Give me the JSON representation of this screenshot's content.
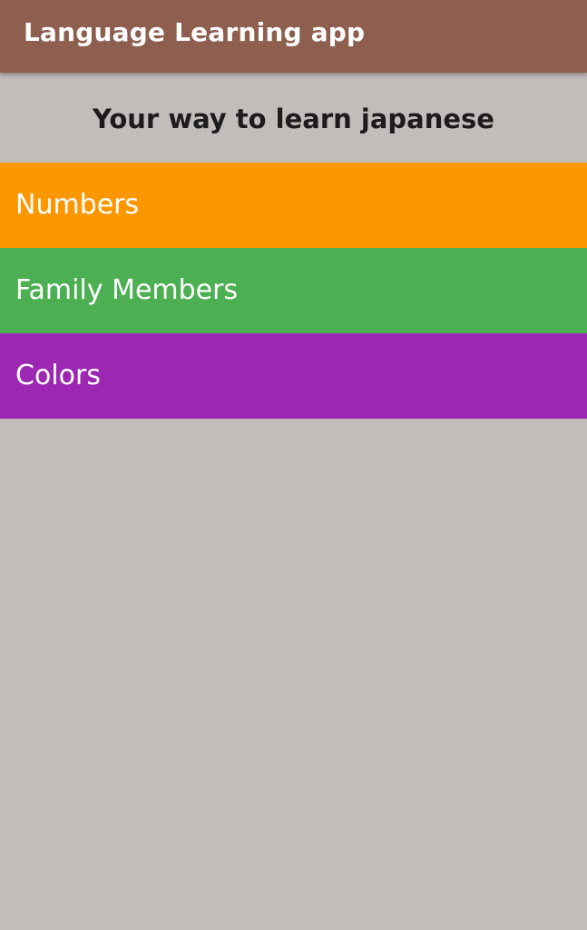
{
  "app_bar": {
    "title": "Language Learning app",
    "color": "#8e5f4e"
  },
  "header": {
    "subtitle": "Your way to learn japanese"
  },
  "categories": [
    {
      "label": "Numbers",
      "color": "#fd9700"
    },
    {
      "label": "Family Members",
      "color": "#4caf51"
    },
    {
      "label": "Colors",
      "color": "#9b27b3"
    }
  ],
  "background_color": "#c2bcbb"
}
